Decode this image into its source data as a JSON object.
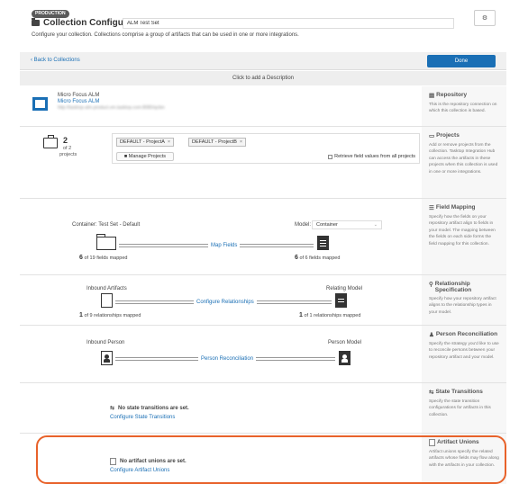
{
  "header": {
    "env_badge": "PRODUCTION",
    "title": "Collection Configuration",
    "name_value": "ALM Test Set",
    "subtitle": "Configure your collection. Collections comprise a group of artifacts that can be used in one or more integrations.",
    "settings_icon": "gear-icon"
  },
  "topbar": {
    "back_label": "Back to Collections",
    "done_label": "Done"
  },
  "description_prompt": "Click to add a Description",
  "repository": {
    "name": "Micro Focus ALM",
    "link": "Micro Focus ALM",
    "url": "http://tasktop-alm.product.vm.tasktop.com:8080/qcbin",
    "side_title": "Repository",
    "side_text": "This is the repository connection on which this collection is based."
  },
  "projects": {
    "count": "2",
    "of": "of 2",
    "label": "projects",
    "chips": [
      "DEFAULT - ProjectA",
      "DEFAULT - ProjectB"
    ],
    "chip_close": "×",
    "manage_label": "Manage Projects",
    "retrieve_label": "Retrieve field values from all projects",
    "side_title": "Projects",
    "side_text": "Add or remove projects from the collection. Tasktop Integration Hub can access the artifacts in these projects when this collection is used in one or more integrations."
  },
  "field_mapping": {
    "container_label": "Container: Test Set - Default",
    "model_label": "Model:",
    "model_value": "Container",
    "link": "Map Fields",
    "left_count": "6",
    "left_text": "of 19 fields mapped",
    "right_count": "6",
    "right_text": "of 6 fields mapped",
    "side_title": "Field Mapping",
    "side_text": "Specify how the fields on your repository artifact align to fields in your model. The mapping between the fields on each side forms the field mapping for this collection."
  },
  "relationships": {
    "left_label": "Inbound Artifacts",
    "right_label": "Relating Model",
    "link": "Configure Relationships",
    "left_count": "1",
    "left_text": "of 9 relationships mapped",
    "right_count": "1",
    "right_text": "of 1 relationships mapped",
    "side_title": "Relationship Specification",
    "side_text": "Specify how your repository artifact aligns to the relationship types in your model."
  },
  "person": {
    "left_label": "Inbound Person",
    "right_label": "Person Model",
    "link": "Person Reconciliation",
    "side_title": "Person Reconciliation",
    "side_text": "Specify the strategy you'd like to use to reconcile persons between your repository artifact and your model."
  },
  "state_transitions": {
    "empty_text": "No state transitions are set.",
    "link": "Configure State Transitions",
    "side_title": "State Transitions",
    "side_text": "Specify the state transition configurations for artifacts in this collection."
  },
  "artifact_unions": {
    "empty_text": "No artifact unions are set.",
    "link": "Configure Artifact Unions",
    "side_title": "Artifact Unions",
    "side_text": "Artifact unions specify the related artifacts whose fields may flow along with the artifacts in your collection."
  },
  "colors": {
    "accent": "#1a6fb5",
    "highlight": "#e8622a"
  }
}
